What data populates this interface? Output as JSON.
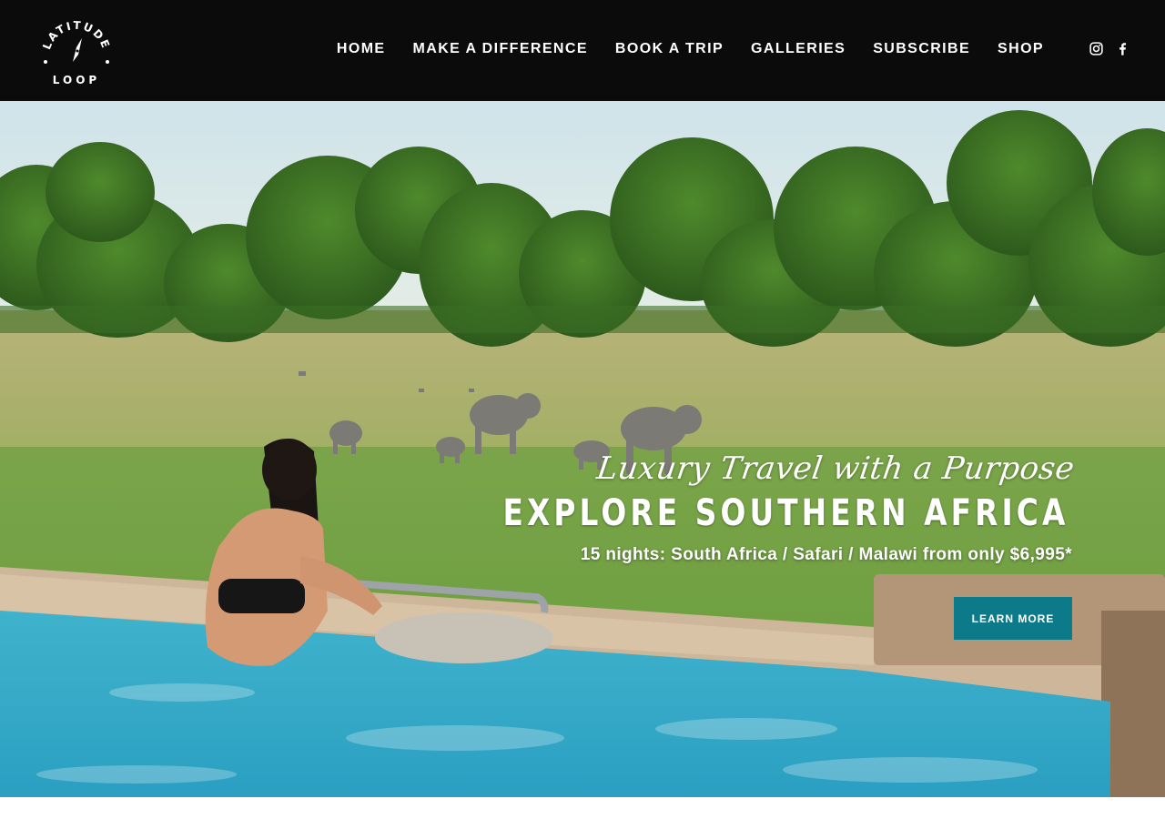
{
  "brand": {
    "logo_top": "LATITUDE",
    "logo_bottom": "LOOP"
  },
  "nav": {
    "items": [
      {
        "label": "HOME"
      },
      {
        "label": "MAKE A DIFFERENCE"
      },
      {
        "label": "BOOK A TRIP"
      },
      {
        "label": "GALLERIES"
      },
      {
        "label": "SUBSCRIBE"
      },
      {
        "label": "SHOP"
      }
    ],
    "social": [
      "instagram-icon",
      "facebook-icon"
    ]
  },
  "hero": {
    "tagline": "Luxury Travel with a Purpose",
    "headline": "EXPLORE SOUTHERN AFRICA",
    "subline": "15 nights: South Africa / Safari / Malawi from only $6,995*",
    "cta_label": "LEARN MORE"
  },
  "colors": {
    "header_bg": "#0b0b0b",
    "accent": "#0d7a8a",
    "text_light": "#ffffff"
  }
}
